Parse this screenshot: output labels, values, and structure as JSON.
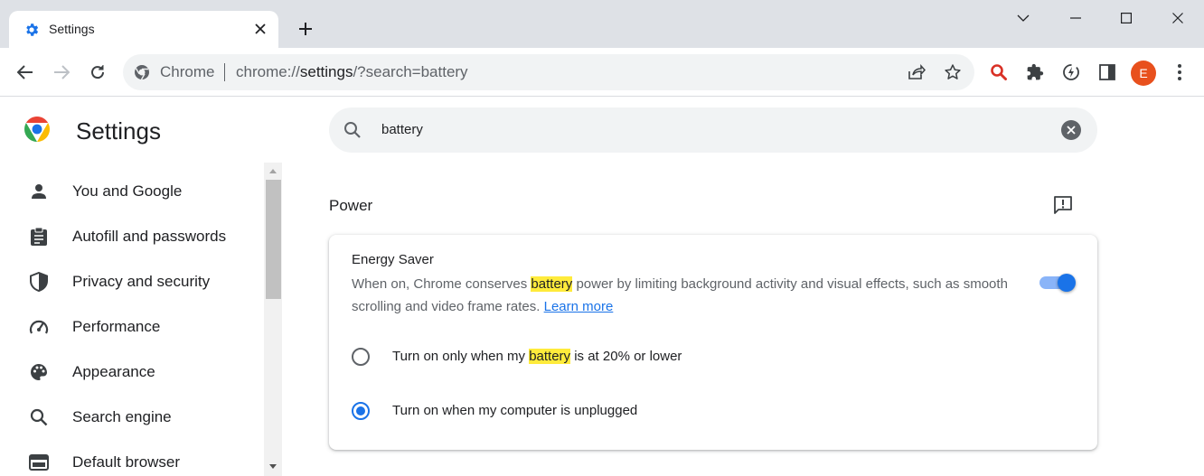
{
  "browser": {
    "tab": {
      "title": "Settings"
    },
    "toolbar": {
      "omnibox_chip": "Chrome",
      "url_scheme": "chrome://",
      "url_host": "settings",
      "url_rest": "/?search=battery"
    },
    "avatar_letter": "E",
    "colors": {
      "accent": "#1a73e8",
      "avatar": "#e8501d",
      "highlight": "#ffeb3b"
    }
  },
  "settings": {
    "title": "Settings",
    "search": {
      "value": "battery"
    },
    "sidebar": {
      "items": [
        {
          "label": "You and Google",
          "icon": "person-icon"
        },
        {
          "label": "Autofill and passwords",
          "icon": "clipboard-icon"
        },
        {
          "label": "Privacy and security",
          "icon": "shield-icon"
        },
        {
          "label": "Performance",
          "icon": "speedometer-icon"
        },
        {
          "label": "Appearance",
          "icon": "palette-icon"
        },
        {
          "label": "Search engine",
          "icon": "search-icon"
        },
        {
          "label": "Default browser",
          "icon": "browser-window-icon"
        }
      ]
    },
    "section": {
      "title": "Power",
      "energy_saver": {
        "title": "Energy Saver",
        "desc_before": "When on, Chrome conserves ",
        "desc_highlight": "battery",
        "desc_after": " power by limiting background activity and visual effects, such as smooth scrolling and video frame rates. ",
        "learn_more": "Learn more",
        "enabled": true
      },
      "options": [
        {
          "before": "Turn on only when my ",
          "highlight": "battery",
          "after": " is at 20% or lower",
          "checked": false
        },
        {
          "before": "Turn on when my computer is unplugged",
          "highlight": "",
          "after": "",
          "checked": true
        }
      ]
    }
  }
}
